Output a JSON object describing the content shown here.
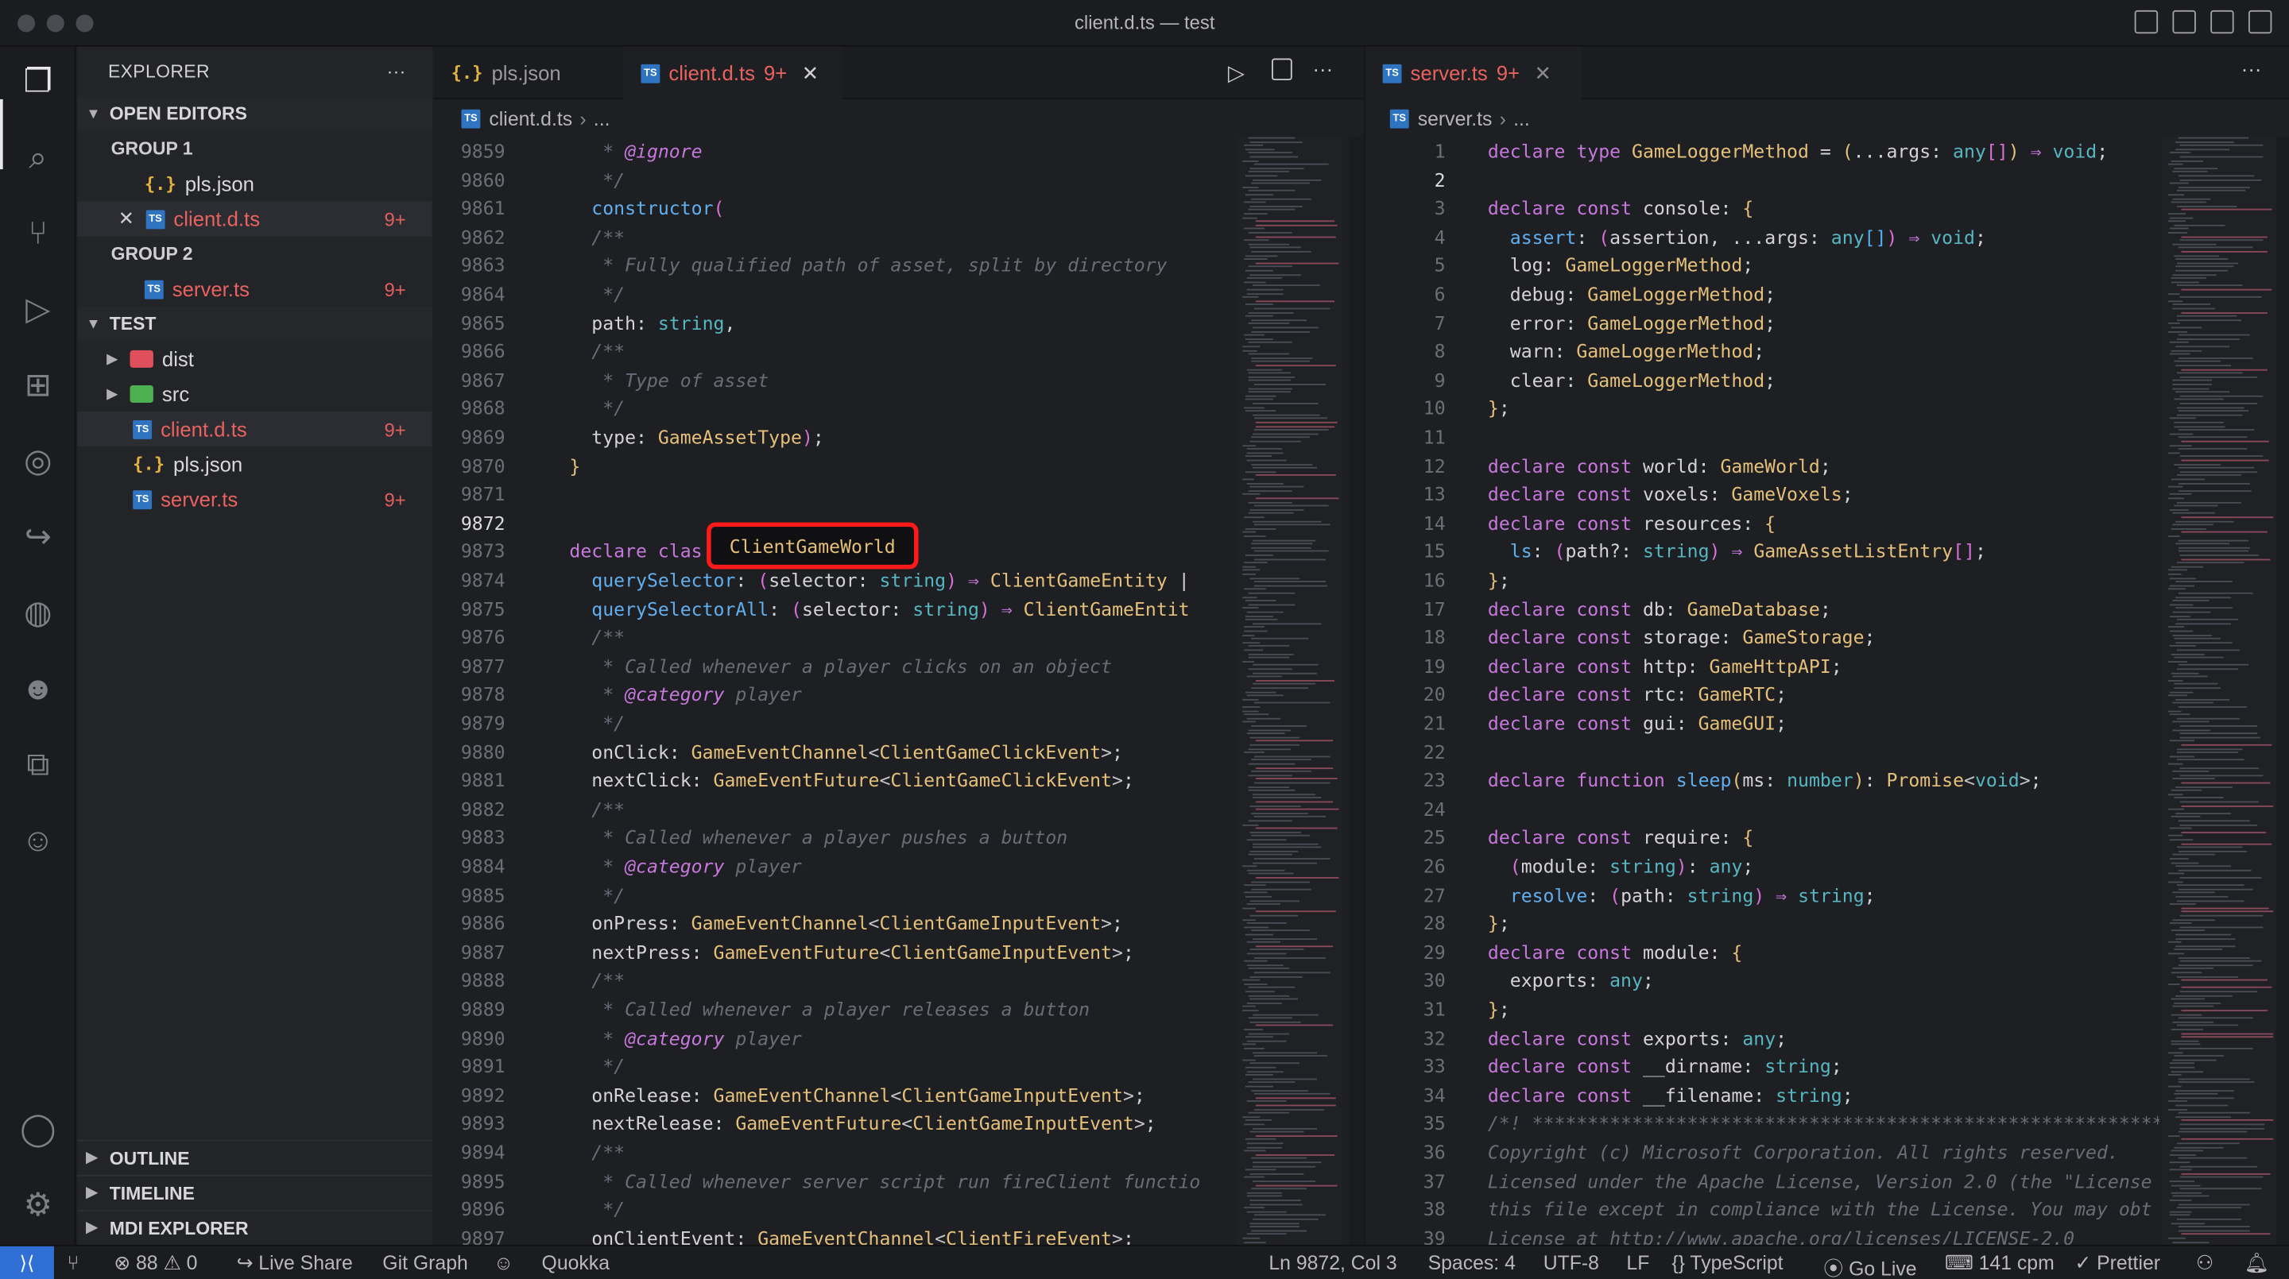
{
  "window": {
    "title": "client.d.ts — test"
  },
  "sidebar": {
    "title": "EXPLORER",
    "more": "···",
    "open_editors": "OPEN EDITORS",
    "group1": "GROUP 1",
    "group2": "GROUP 2",
    "g1_items": [
      {
        "name": "pls.json",
        "badge": ""
      },
      {
        "name": "client.d.ts",
        "badge": "9+"
      }
    ],
    "g2_items": [
      {
        "name": "server.ts",
        "badge": "9+"
      }
    ],
    "project": "TEST",
    "tree": [
      {
        "name": "dist",
        "badge": ""
      },
      {
        "name": "src",
        "badge": ""
      },
      {
        "name": "client.d.ts",
        "badge": "9+"
      },
      {
        "name": "pls.json",
        "badge": ""
      },
      {
        "name": "server.ts",
        "badge": "9+"
      }
    ],
    "outline": "OUTLINE",
    "timeline": "TIMELINE",
    "mdi": "MDI EXPLORER"
  },
  "left_editor": {
    "tabs": [
      {
        "label": "pls.json"
      },
      {
        "label": "client.d.ts",
        "badge": "9+",
        "close": "✕"
      }
    ],
    "breadcrumb_file": "client.d.ts",
    "breadcrumb_rest": "...",
    "lines": [
      "9859",
      "9860",
      "9861",
      "9862",
      "9863",
      "9864",
      "9865",
      "9866",
      "9867",
      "9868",
      "9869",
      "9870",
      "9871",
      "9872",
      "9873",
      "9874",
      "9875",
      "9876",
      "9877",
      "9878",
      "9879",
      "9880",
      "9881",
      "9882",
      "9883",
      "9884",
      "9885",
      "9886",
      "9887",
      "9888",
      "9889",
      "9890",
      "9891",
      "9892",
      "9893",
      "9894",
      "9895",
      "9896",
      "9897"
    ],
    "highlight": "ClientGameWorld"
  },
  "right_editor": {
    "tabs": [
      {
        "label": "server.ts",
        "badge": "9+",
        "close": "✕"
      }
    ],
    "breadcrumb_file": "server.ts",
    "breadcrumb_rest": "...",
    "lines": [
      "1",
      "2",
      "3",
      "4",
      "5",
      "6",
      "7",
      "8",
      "9",
      "10",
      "11",
      "12",
      "13",
      "14",
      "15",
      "16",
      "17",
      "18",
      "19",
      "20",
      "21",
      "22",
      "23",
      "24",
      "25",
      "26",
      "27",
      "28",
      "29",
      "30",
      "31",
      "32",
      "33",
      "34",
      "35",
      "36",
      "37",
      "38",
      "39"
    ]
  },
  "status": {
    "errors": "88",
    "warnings": "0",
    "live_share": "Live Share",
    "git_graph": "Git Graph",
    "quokka": "Quokka",
    "position": "Ln 9872, Col 3",
    "spaces": "Spaces: 4",
    "encoding": "UTF-8",
    "eol": "LF",
    "language": "TypeScript",
    "go_live": "Go Live",
    "cpm": "141 cpm",
    "prettier": "Prettier"
  }
}
